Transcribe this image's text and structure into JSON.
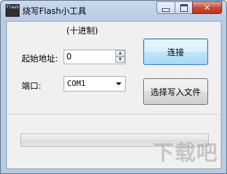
{
  "window": {
    "title": "烧写Flash小工具",
    "app_icon_text": "Flash",
    "controls": {
      "minimize_icon": "minimize-icon",
      "maximize_icon": "maximize-icon",
      "close_icon": "close-icon",
      "close_glyph": "✕"
    }
  },
  "form": {
    "hint": "(十进制)",
    "address_label": "起始地址:",
    "address_value": "0",
    "port_label": "端口:",
    "port_value": "COM1"
  },
  "buttons": {
    "connect": "连接",
    "select_file": "选择写入文件"
  },
  "progress": {
    "percent": 0
  },
  "watermark": "下载吧",
  "colors": {
    "window_frame": "#b7cbe3",
    "client_bg": "#f0f0f0",
    "focus_button": "#bee6fd",
    "close_button": "#c94a36"
  }
}
